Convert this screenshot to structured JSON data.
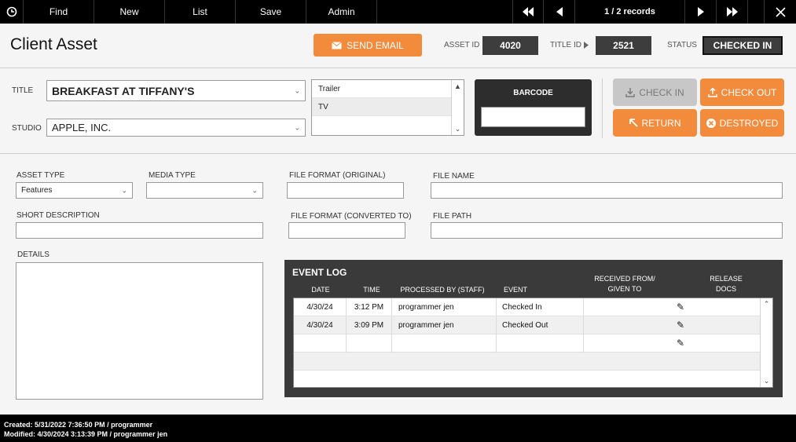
{
  "toolbar": {
    "find": "Find",
    "new": "New",
    "list": "List",
    "save": "Save",
    "admin": "Admin",
    "record_counter": "1 / 2 records"
  },
  "header": {
    "title": "Client Asset",
    "send_email": "SEND EMAIL",
    "asset_id_label": "ASSET ID",
    "asset_id": "4020",
    "title_id_label": "TITLE ID",
    "title_id": "2521",
    "status_label": "STATUS",
    "status": "CHECKED IN"
  },
  "form": {
    "title_label": "TITLE",
    "title_value": "BREAKFAST AT TIFFANY'S",
    "studio_label": "STUDIO",
    "studio_value": "APPLE, INC.",
    "type_options": [
      "Trailer",
      "TV"
    ],
    "barcode_label": "BARCODE",
    "barcode_value": "",
    "asset_type_label": "ASSET TYPE",
    "asset_type_value": "Features",
    "media_type_label": "MEDIA TYPE",
    "media_type_value": "",
    "file_format_original_label": "FILE FORMAT (ORIGINAL)",
    "file_name_label": "FILE NAME",
    "short_description_label": "SHORT DESCRIPTION",
    "file_format_converted_label": "FILE FORMAT (CONVERTED TO)",
    "file_path_label": "FILE PATH",
    "details_label": "DETAILS"
  },
  "actions": {
    "check_in": "CHECK IN",
    "check_out": "CHECK OUT",
    "return": "RETURN",
    "destroyed": "DESTROYED"
  },
  "event_log": {
    "title": "EVENT LOG",
    "headers": {
      "date": "DATE",
      "time": "TIME",
      "processed_by": "PROCESSED BY (STAFF)",
      "event": "EVENT",
      "received_line1": "RECEIVED FROM/",
      "received_line2": "GIVEN TO",
      "release_line1": "RELEASE",
      "release_line2": "DOCS"
    },
    "rows": [
      {
        "date": "4/30/24",
        "time": "3:12 PM",
        "staff": "programmer jen",
        "event": "Checked In"
      },
      {
        "date": "4/30/24",
        "time": "3:09 PM",
        "staff": "programmer jen",
        "event": "Checked Out"
      }
    ]
  },
  "footer": {
    "created": "Created: 5/31/2022 7:36:50 PM / programmer",
    "modified": "Modified: 4/30/2024 3:13:39 PM / programmer jen"
  },
  "colors": {
    "accent": "#f28b3c",
    "dark": "#3a3a3a",
    "toolbar": "#000000"
  }
}
